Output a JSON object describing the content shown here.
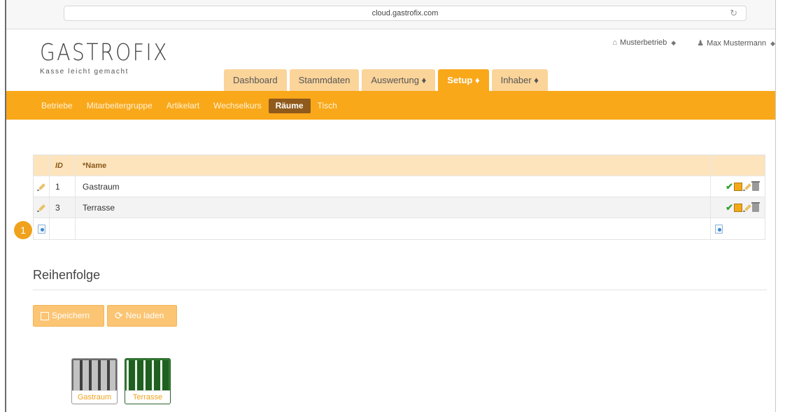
{
  "browser": {
    "url": "cloud.gastrofix.com",
    "reload_icon": "reload-icon"
  },
  "header": {
    "logo": "GASTROFIX",
    "tagline": "Kasse leicht gemacht",
    "business": "Musterbetrieb",
    "user": "Max Mustermann"
  },
  "tabs": [
    {
      "label": "Dashboard",
      "active": false
    },
    {
      "label": "Stammdaten",
      "active": false
    },
    {
      "label": "Auswertung ♦",
      "active": false
    },
    {
      "label": "Setup ♦",
      "active": true
    },
    {
      "label": "Inhaber ♦",
      "active": false
    }
  ],
  "subnav": [
    {
      "label": "Betriebe",
      "active": false
    },
    {
      "label": "Mitarbeitergruppe",
      "active": false
    },
    {
      "label": "Artikelart",
      "active": false
    },
    {
      "label": "Wechselkurs",
      "active": false
    },
    {
      "label": "Räume",
      "active": true
    },
    {
      "label": "Tisch",
      "active": false
    }
  ],
  "table": {
    "columns": {
      "id": "ID",
      "name": "*Name"
    },
    "rows": [
      {
        "id": "1",
        "name": "Gastraum"
      },
      {
        "id": "3",
        "name": "Terrasse"
      }
    ]
  },
  "badge": "1",
  "order": {
    "title": "Reihenfolge",
    "save_label": "Speichern",
    "reload_label": "Neu laden",
    "rooms": [
      "Gastraum",
      "Terrasse"
    ]
  },
  "colors": {
    "accent": "#f9a81a",
    "active_subnav": "#8f5a1b",
    "table_head": "#fde4bd"
  }
}
